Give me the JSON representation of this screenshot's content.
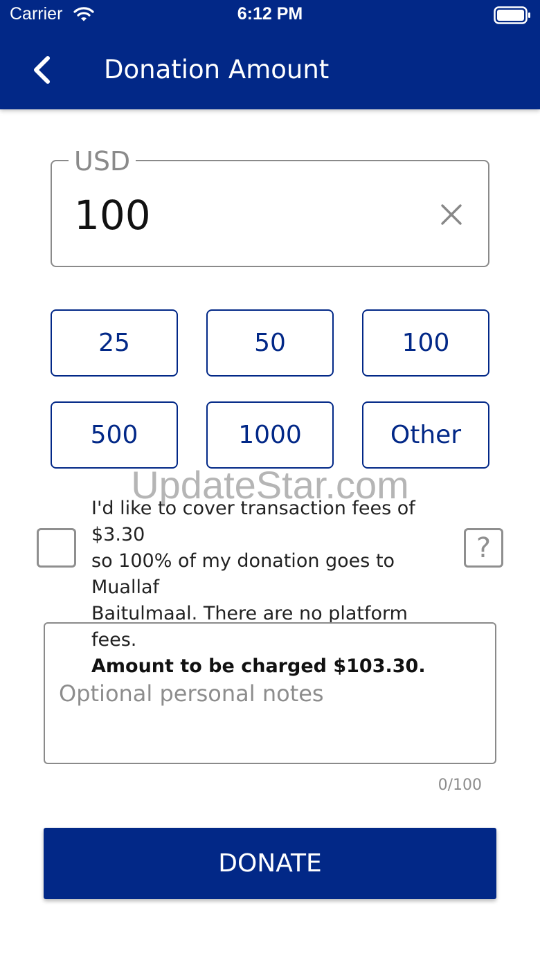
{
  "status_bar": {
    "carrier": "Carrier",
    "time": "6:12 PM",
    "icons": [
      "wifi-icon",
      "battery-icon"
    ]
  },
  "nav": {
    "back_icon": "chevron-left-icon",
    "title": "Donation Amount"
  },
  "amount": {
    "currency_label": "USD",
    "value": "100",
    "clear_icon": "close-icon"
  },
  "presets": [
    "25",
    "50",
    "100",
    "500",
    "1000",
    "Other"
  ],
  "fees": {
    "checked": false,
    "line1": "I'd like to cover transaction fees of $3.30",
    "line2": "so 100% of my donation goes to Muallaf",
    "line3": "Baitulmaal. There are no platform fees.",
    "charge_text": "Amount to be charged $103.30.",
    "help_label": "?"
  },
  "watermark": "UpdateStar.com",
  "notes": {
    "placeholder": "Optional personal notes",
    "counter": "0/100"
  },
  "donate_label": "DONATE",
  "colors": {
    "primary": "#022887",
    "border_gray": "#8a8a8a",
    "background": "#ffffff"
  }
}
